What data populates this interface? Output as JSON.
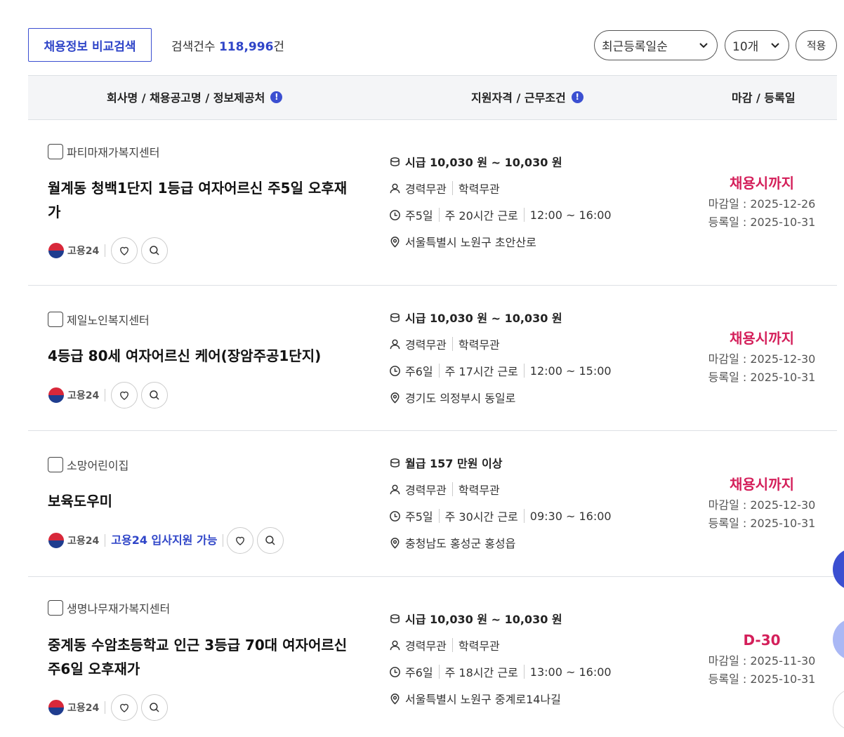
{
  "toolbar": {
    "compare_label": "채용정보 비교검색",
    "count_prefix": "검색건수",
    "count_value": "118,996",
    "count_suffix": "건",
    "sort_value": "최근등록일순",
    "per_page_value": "10개",
    "apply_label": "적용"
  },
  "table_header": {
    "col1": "회사명 / 채용공고명 / 정보제공처",
    "col2": "지원자격 / 근무조건",
    "col3": "마감 / 등록일",
    "info_glyph": "!"
  },
  "logo_text": "고용24",
  "jobs": [
    {
      "company": "파티마재가복지센터",
      "title": "월계동 청백1단지 1등급 여자어르신 주5일 오후재가",
      "support": "",
      "pay": "시급 10,030 원 ~ 10,030 원",
      "career": "경력무관",
      "education": "학력무관",
      "days": "주5일",
      "hours": "주 20시간 근로",
      "time": "12:00 ~ 16:00",
      "location": "서울특별시 노원구 초안산로",
      "deadline": "채용시까지",
      "close_date": "마감일 : 2025-12-26",
      "reg_date": "등록일 : 2025-10-31"
    },
    {
      "company": "제일노인복지센터",
      "title": "4등급 80세 여자어르신 케어(장암주공1단지)",
      "support": "",
      "pay": "시급 10,030 원 ~ 10,030 원",
      "career": "경력무관",
      "education": "학력무관",
      "days": "주6일",
      "hours": "주 17시간 근로",
      "time": "12:00 ~ 15:00",
      "location": "경기도 의정부시 동일로",
      "deadline": "채용시까지",
      "close_date": "마감일 : 2025-12-30",
      "reg_date": "등록일 : 2025-10-31"
    },
    {
      "company": "소망어린이집",
      "title": "보육도우미",
      "support": "고용24 입사지원 가능",
      "pay": "월급 157 만원 이상",
      "career": "경력무관",
      "education": "학력무관",
      "days": "주5일",
      "hours": "주 30시간 근로",
      "time": "09:30 ~ 16:00",
      "location": "충청남도 홍성군 홍성읍",
      "deadline": "채용시까지",
      "close_date": "마감일 : 2025-12-30",
      "reg_date": "등록일 : 2025-10-31"
    },
    {
      "company": "생명나무재가복지센터",
      "title": "중계동 수암초등학교 인근 3등급 70대 여자어르신 주6일 오후재가",
      "support": "",
      "pay": "시급 10,030 원 ~ 10,030 원",
      "career": "경력무관",
      "education": "학력무관",
      "days": "주6일",
      "hours": "주 18시간 근로",
      "time": "13:00 ~ 16:00",
      "location": "서울특별시 노원구 중계로14나길",
      "deadline": "D-30",
      "close_date": "마감일 : 2025-11-30",
      "reg_date": "등록일 : 2025-10-31"
    }
  ],
  "colors": {
    "accent": "#3b4fd1",
    "deadline": "#d41f5a",
    "header_bg": "#f4f5f7"
  }
}
